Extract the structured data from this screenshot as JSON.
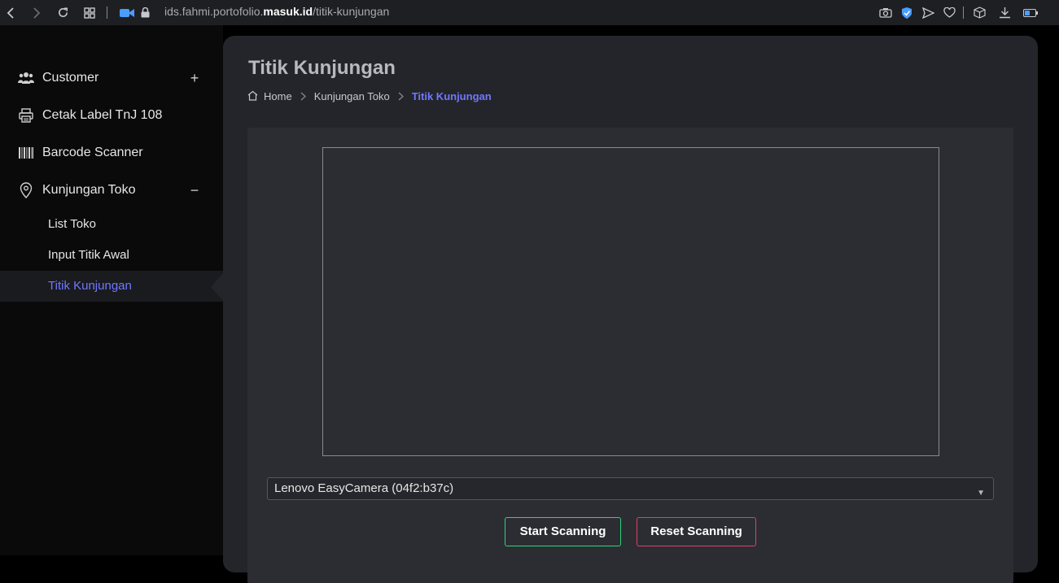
{
  "browser": {
    "url_prefix": "ids.fahmi.portofolio.",
    "url_domain": "masuk.id",
    "url_path": "/titik-kunjungan",
    "icons": [
      "back-icon",
      "forward-icon",
      "reload-icon",
      "tabs-grid-icon",
      "camera-icon",
      "lock-icon",
      "screenshot-icon",
      "shield-icon",
      "send-icon",
      "heart-icon",
      "box-icon",
      "download-icon",
      "battery-icon"
    ]
  },
  "sidebar": {
    "items": [
      {
        "label": "Customer",
        "icon": "users-icon",
        "toggle": "+"
      },
      {
        "label": "Cetak Label TnJ 108",
        "icon": "printer-icon"
      },
      {
        "label": "Barcode Scanner",
        "icon": "barcode-icon"
      },
      {
        "label": "Kunjungan Toko",
        "icon": "map-pin-icon",
        "toggle": "−"
      }
    ],
    "subitems": [
      {
        "label": "List Toko"
      },
      {
        "label": "Input Titik Awal"
      },
      {
        "label": "Titik Kunjungan",
        "active": true
      }
    ]
  },
  "main": {
    "title": "Titik Kunjungan",
    "breadcrumb": [
      "Home",
      "Kunjungan Toko",
      "Titik Kunjungan"
    ],
    "camera_select": "Lenovo EasyCamera (04f2:b37c)",
    "start_label": "Start Scanning",
    "reset_label": "Reset Scanning"
  },
  "colors": {
    "accent": "#6f78ff",
    "start_border": "#2ed47a",
    "reset_border": "#e0405e"
  }
}
